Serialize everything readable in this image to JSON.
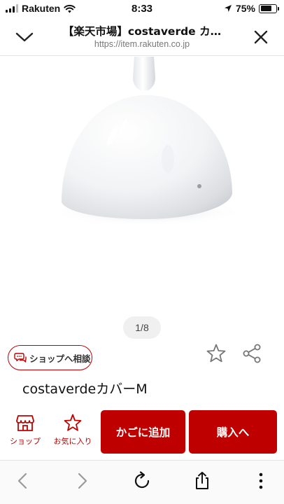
{
  "status_bar": {
    "carrier": "Rakuten",
    "time": "8:33",
    "battery_percent": "75%",
    "battery_level": 0.75
  },
  "browser": {
    "title": "【楽天市場】costaverde カ…",
    "url": "https://item.rakuten.co.jp"
  },
  "gallery": {
    "pager": "1/8"
  },
  "product": {
    "consult_label": "ショップへ相談",
    "name": "costaverdeカバーM"
  },
  "actions": {
    "shop_label": "ショップ",
    "favorite_label": "お気に入り",
    "cart_label": "かごに追加",
    "buy_label": "購入へ"
  },
  "colors": {
    "brand_red": "#bf0000",
    "text": "#111111",
    "muted": "#777777"
  },
  "icons": {
    "header_left": "chevron-down-icon",
    "header_right": "close-icon",
    "toolbar": [
      "back-icon",
      "forward-icon",
      "reload-icon",
      "share-icon",
      "more-icon"
    ]
  }
}
